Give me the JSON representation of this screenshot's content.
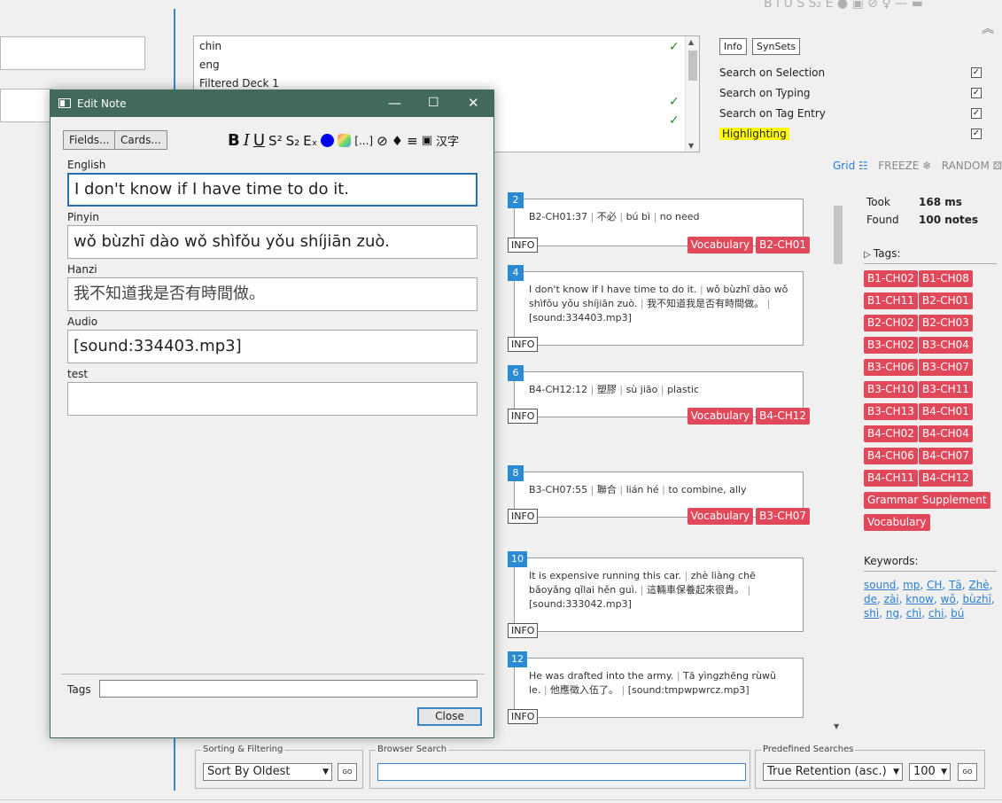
{
  "toolbar_top_glyphs": "B I U S S₂ E ● ▣ ⊘ ♀ — ▬",
  "deck_list": {
    "rows": [
      {
        "name": "chin",
        "checked": "✓"
      },
      {
        "name": "eng",
        "checked": ""
      },
      {
        "name": "Filtered Deck 1",
        "checked": ""
      },
      {
        "name": "",
        "checked": "✓"
      },
      {
        "name": "",
        "checked": "✓"
      }
    ]
  },
  "right_panel": {
    "info_button": "Info",
    "synsets_button": "SynSets",
    "options": [
      {
        "label": "Search on Selection",
        "checked": "✓"
      },
      {
        "label": "Search on Typing",
        "checked": "✓"
      },
      {
        "label": "Search on Tag Entry",
        "checked": "✓"
      },
      {
        "label": "Highlighting",
        "checked": "✓"
      }
    ],
    "view_modes": {
      "grid": "Grid ☷",
      "freeze": "FREEZE ❄",
      "random": "RANDOM ⚄"
    }
  },
  "stats": {
    "took_label": "Took",
    "took_value": "168 ms",
    "found_label": "Found",
    "found_value": "100 notes"
  },
  "tags_title": "Tags:",
  "tags": [
    "B1-CH02",
    "B1-CH08",
    "B1-CH11",
    "B2-CH01",
    "B2-CH02",
    "B2-CH03",
    "B3-CH02",
    "B3-CH04",
    "B3-CH06",
    "B3-CH07",
    "B3-CH10",
    "B3-CH11",
    "B3-CH13",
    "B4-CH01",
    "B4-CH02",
    "B4-CH04",
    "B4-CH06",
    "B4-CH07",
    "B4-CH11",
    "B4-CH12",
    "Grammar",
    "Supplement",
    "Vocabulary"
  ],
  "keywords_title": "Keywords:",
  "keywords": [
    "sound",
    "mp",
    "CH",
    "Tā",
    "Zhè",
    "de",
    "zài",
    "know",
    "wǒ",
    "bùzhī",
    "shì",
    "ng",
    "chì",
    "chi",
    "bú"
  ],
  "cards": [
    {
      "num": "2",
      "parts": [
        "B2-CH01:37",
        "不必",
        "bú bì",
        "no need"
      ],
      "info": "INFO",
      "tags": [
        "Vocabulary",
        "B2-CH01"
      ]
    },
    {
      "num": "4",
      "parts": [
        "I don't know if I have time to do it.",
        "wǒ bùzhī dào wǒ shìfǒu yǒu shíjiān zuò.",
        "我不知道我是否有時間做。",
        "[sound:334403.mp3]"
      ],
      "info": "INFO",
      "tags": []
    },
    {
      "num": "6",
      "parts": [
        "B4-CH12:12",
        "塑膠",
        "sù jiāo",
        "plastic"
      ],
      "info": "INFO",
      "tags": [
        "Vocabulary",
        "B4-CH12"
      ]
    },
    {
      "num": "8",
      "parts": [
        "B3-CH07:55",
        "聯合",
        "lián hé",
        "to combine, ally"
      ],
      "info": "INFO",
      "tags": [
        "Vocabulary",
        "B3-CH07"
      ]
    },
    {
      "num": "10",
      "parts": [
        "It is expensive running this car.",
        "zhè liàng chē bǎoyǎng qǐlai hěn guì.",
        "這輛車保養起來很貴。",
        "[sound:333042.mp3]"
      ],
      "info": "INFO",
      "tags": []
    },
    {
      "num": "12",
      "parts": [
        "He was drafted into the army.",
        "Tā yìngzhēng rùwǔ le.",
        "他應徵入伍了。",
        "[sound:tmpwpwrcz.mp3]"
      ],
      "info": "INFO",
      "tags": []
    }
  ],
  "bottom": {
    "sorting_legend": "Sorting & Filtering",
    "sort_value": "Sort By Oldest",
    "go_label": "GO",
    "browser_search_legend": "Browser Search",
    "browser_search_value": "",
    "predefined_legend": "Predefined Searches",
    "predefined_value": "True Retention (asc.)",
    "count_value": "100"
  },
  "dialog": {
    "title": "Edit Note",
    "fields_button": "Fields...",
    "cards_button": "Cards...",
    "hanzi_button": "汉字",
    "fields": [
      {
        "label": "English",
        "value": "I don't know if I have time to do it."
      },
      {
        "label": "Pinyin",
        "value": "wǒ bùzhī dào wǒ shìfǒu yǒu shíjiān zuò."
      },
      {
        "label": "Hanzi",
        "value": "我不知道我是否有時間做。"
      },
      {
        "label": "Audio",
        "value": "[sound:334403.mp3]"
      },
      {
        "label": "test",
        "value": ""
      }
    ],
    "tags_label": "Tags",
    "tags_value": "",
    "close_button": "Close"
  },
  "colors": {
    "accent": "#2a8ad4",
    "tag": "#e1485a",
    "titlebar": "#426a5a",
    "highlight": "#ffff00"
  }
}
